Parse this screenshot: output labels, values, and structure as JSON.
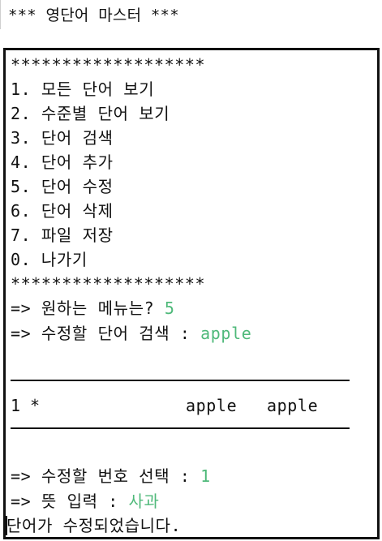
{
  "title": "*** 영단어 마스터 ***",
  "menu": {
    "border_top": "*******************",
    "items": [
      "1. 모든 단어 보기",
      "2. 수준별 단어 보기",
      "3. 단어 검색",
      "4. 단어 추가",
      "5. 단어 수정",
      "6. 단어 삭제",
      "7. 파일 저장",
      "0. 나가기"
    ],
    "border_bottom": "*******************"
  },
  "prompts": {
    "menu_prompt": "=> 원하는 메뉴는? ",
    "menu_input": "5",
    "search_prompt": "=> 수정할 단어 검색 : ",
    "search_input": "apple"
  },
  "result_table": {
    "rows": [
      {
        "number": "1",
        "level": "*",
        "word": "apple",
        "meaning": "apple"
      }
    ]
  },
  "edit": {
    "select_prompt": "=> 수정할 번호 선택 : ",
    "select_input": "1",
    "meaning_prompt": "=> 뜻 입력 : ",
    "meaning_input": "사과",
    "result_message": "단어가 수정되었습니다."
  },
  "colors": {
    "user_input": "#4fb97a",
    "text": "#111111"
  }
}
